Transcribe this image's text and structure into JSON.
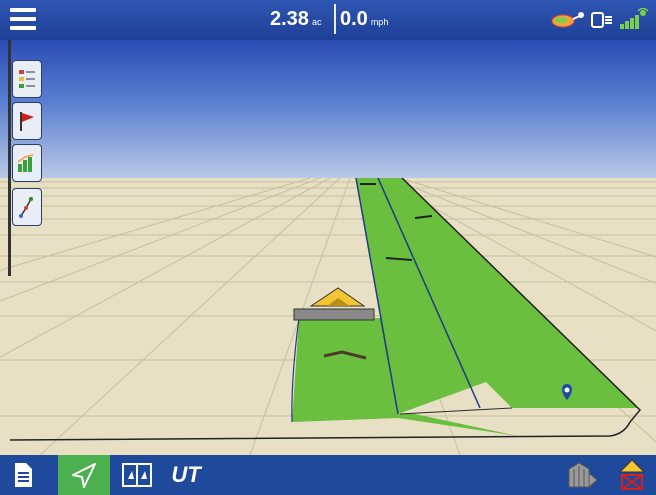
{
  "header": {
    "area": {
      "value": "2.38",
      "unit": "ac"
    },
    "speed": {
      "value": "0.0",
      "unit": "mph"
    },
    "status_icons": [
      "gps-antenna-icon",
      "ag-leader-device-icon",
      "satellite-signal-icon"
    ]
  },
  "menu": {
    "icon": "hamburger-menu-icon"
  },
  "side_toolbar": {
    "items": [
      {
        "name": "legend-tool",
        "icon": "legend-icon"
      },
      {
        "name": "flag-tool",
        "icon": "flag-icon"
      },
      {
        "name": "yield-chart-tool",
        "icon": "bar-chart-icon"
      },
      {
        "name": "guidance-tool",
        "icon": "guidance-line-icon"
      }
    ]
  },
  "bottom_toolbar": {
    "items": [
      {
        "name": "summary-button",
        "icon": "document-icon"
      },
      {
        "name": "guidance-button",
        "icon": "navigation-arrow-icon",
        "active": true
      },
      {
        "name": "map-view-button",
        "icon": "split-map-icon"
      },
      {
        "name": "universal-terminal-button",
        "icon": "ut-icon",
        "label": "UT"
      },
      {
        "name": "master-switch-button",
        "icon": "implement-rows-icon"
      },
      {
        "name": "boundary-off-button",
        "icon": "boundary-marker-icon"
      }
    ]
  },
  "colors": {
    "top_bar": "#2f57b3",
    "bottom_bar": "#1f4a9c",
    "coverage": "#6abf3f",
    "ground": "#e8e0c4",
    "active_button": "#4caf50"
  }
}
